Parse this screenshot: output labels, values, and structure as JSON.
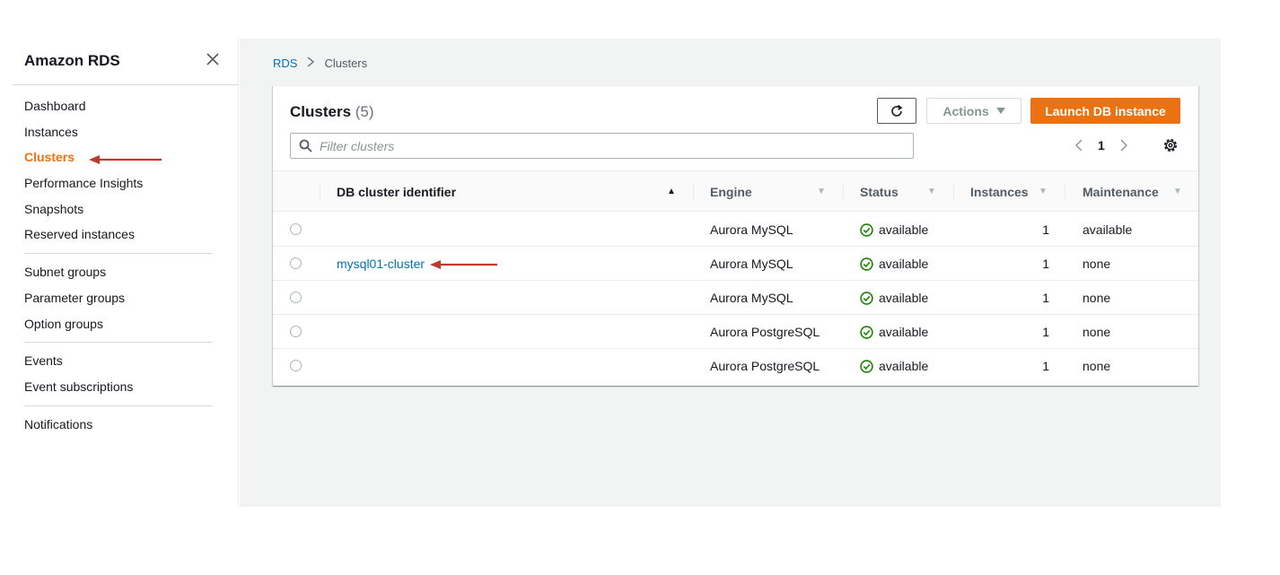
{
  "sidebar": {
    "title": "Amazon RDS",
    "groups": [
      [
        "Dashboard",
        "Instances",
        "Clusters",
        "Performance Insights",
        "Snapshots",
        "Reserved instances"
      ],
      [
        "Subnet groups",
        "Parameter groups",
        "Option groups"
      ],
      [
        "Events",
        "Event subscriptions"
      ],
      [
        "Notifications"
      ]
    ],
    "active_item": "Clusters",
    "icons": {
      "close": "close-icon"
    }
  },
  "breadcrumb": {
    "root": "RDS",
    "separator": ">",
    "current": "Clusters"
  },
  "panel": {
    "title": "Clusters",
    "count": "(5)",
    "actions_label": "Actions",
    "launch_label": "Launch DB instance",
    "filter_placeholder": "Filter clusters",
    "page_number": "1",
    "icons": {
      "refresh": "refresh-icon",
      "search": "search-icon",
      "settings": "gear-icon",
      "prev": "chevron-left-icon",
      "next": "chevron-right-icon"
    }
  },
  "table": {
    "columns": [
      "DB cluster identifier",
      "Engine",
      "Status",
      "Instances",
      "Maintenance"
    ],
    "rows": [
      {
        "identifier": "",
        "engine": "Aurora MySQL",
        "status": "available",
        "instances": "1",
        "maintenance": "available"
      },
      {
        "identifier": "mysql01-cluster",
        "engine": "Aurora MySQL",
        "status": "available",
        "instances": "1",
        "maintenance": "none"
      },
      {
        "identifier": "",
        "engine": "Aurora MySQL",
        "status": "available",
        "instances": "1",
        "maintenance": "none"
      },
      {
        "identifier": "",
        "engine": "Aurora PostgreSQL",
        "status": "available",
        "instances": "1",
        "maintenance": "none"
      },
      {
        "identifier": "",
        "engine": "Aurora PostgreSQL",
        "status": "available",
        "instances": "1",
        "maintenance": "none"
      }
    ]
  },
  "colors": {
    "accent_orange": "#ec7211",
    "link_blue": "#0073bb",
    "status_green": "#1d8102",
    "annotation_red": "#c0392b"
  }
}
